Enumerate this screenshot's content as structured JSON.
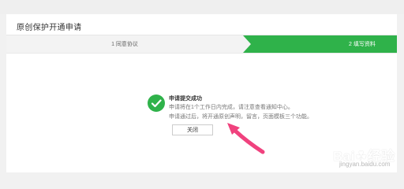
{
  "panel": {
    "title": "原创保护开通申请"
  },
  "steps": [
    {
      "label": "1 同意协议",
      "active": false
    },
    {
      "label": "2 填写资料",
      "active": true
    }
  ],
  "message": {
    "title": "申请提交成功",
    "line1": "申请将在1个工作日内完成，请注意查看通知中心。",
    "line2": "申请通过后，将开通原创声明，留言，页面模板三个功能。"
  },
  "actions": {
    "close_label": "关闭"
  },
  "watermark": {
    "text": "Bai",
    "text2": "经验",
    "sub": "jingyan.baidu.com"
  },
  "colors": {
    "accent": "#2fb24a",
    "annotation": "#f0427e"
  },
  "icons": {
    "success": "check-circle-icon",
    "annotation": "arrow-icon"
  }
}
